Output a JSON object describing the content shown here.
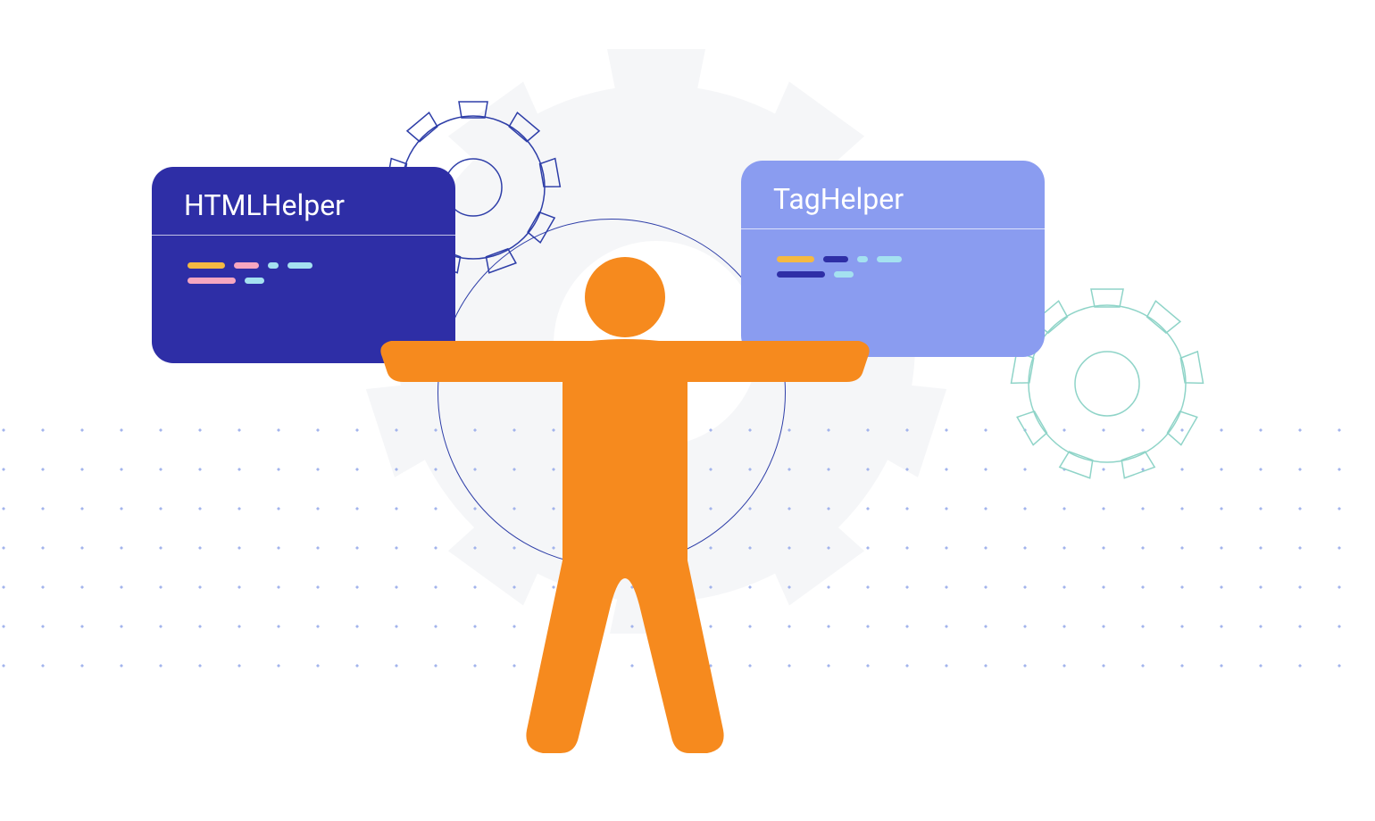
{
  "cards": {
    "left": {
      "title": "HTMLHelper",
      "bg_color": "#2e2ea6",
      "code_colors": {
        "yellow": "#f4b942",
        "pink": "#f6a6c0",
        "cyan": "#a4e1f0"
      }
    },
    "right": {
      "title": "TagHelper",
      "bg_color": "#8a9cf0",
      "code_colors": {
        "yellow": "#f4b942",
        "darkblue": "#2e2ea6",
        "cyan": "#a4e1f0"
      }
    }
  },
  "figure": {
    "color": "#f68a1e"
  },
  "decorations": {
    "big_gear_fill": "#f5f5f7",
    "blue_outline": "#2e3ea8",
    "teal_outline": "#8fd4c8",
    "dot_color": "#a3b4ec"
  }
}
